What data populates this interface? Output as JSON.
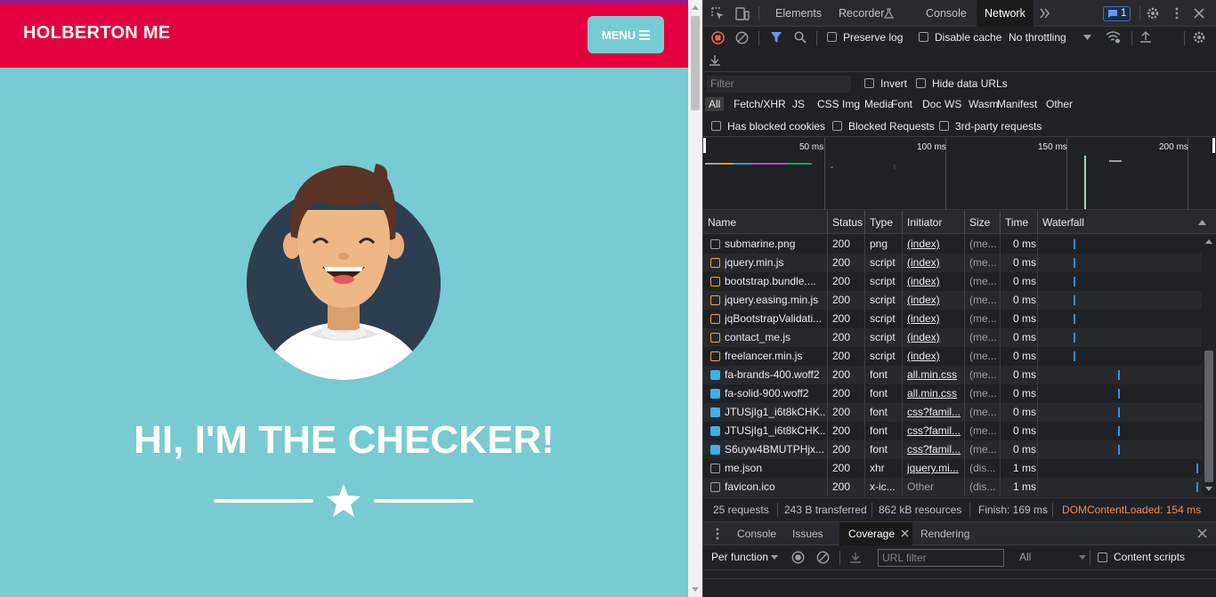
{
  "page": {
    "brand": "HOLBERTON ME",
    "menu_label": "MENU",
    "hero_title": "HI, I'M THE CHECKER!",
    "colors": {
      "navbar": "#e2003e",
      "background": "#78cbd2",
      "text": "#ffffff"
    }
  },
  "devtools": {
    "tabs": [
      "Elements",
      "Recorder",
      "Console",
      "Network"
    ],
    "active_tab": "Network",
    "issues_count": "1",
    "toolbar": {
      "preserve_log": "Preserve log",
      "disable_cache": "Disable cache",
      "throttling": "No throttling"
    },
    "filter": {
      "placeholder": "Filter",
      "invert": "Invert",
      "hide_data_urls": "Hide data URLs",
      "types": [
        "All",
        "Fetch/XHR",
        "JS",
        "CSS",
        "Img",
        "Media",
        "Font",
        "Doc",
        "WS",
        "Wasm",
        "Manifest",
        "Other"
      ],
      "has_blocked_cookies": "Has blocked cookies",
      "blocked_requests": "Blocked Requests",
      "third_party": "3rd-party requests"
    },
    "overview_ticks": [
      "50 ms",
      "100 ms",
      "150 ms",
      "200 ms"
    ],
    "columns": [
      "Name",
      "Status",
      "Type",
      "Initiator",
      "Size",
      "Time",
      "Waterfall"
    ],
    "requests": [
      {
        "name": "submarine.png",
        "status": "200",
        "type": "png",
        "initiator": "(index)",
        "size": "(me...",
        "time": "0 ms",
        "icon": "image-icon",
        "wf": 0.21
      },
      {
        "name": "jquery.min.js",
        "status": "200",
        "type": "script",
        "initiator": "(index)",
        "size": "(me...",
        "time": "0 ms",
        "icon": "script-icon",
        "wf": 0.21
      },
      {
        "name": "bootstrap.bundle....",
        "status": "200",
        "type": "script",
        "initiator": "(index)",
        "size": "(me...",
        "time": "0 ms",
        "icon": "script-icon",
        "wf": 0.21
      },
      {
        "name": "jquery.easing.min.js",
        "status": "200",
        "type": "script",
        "initiator": "(index)",
        "size": "(me...",
        "time": "0 ms",
        "icon": "script-icon",
        "wf": 0.21
      },
      {
        "name": "jqBootstrapValidati...",
        "status": "200",
        "type": "script",
        "initiator": "(index)",
        "size": "(me...",
        "time": "0 ms",
        "icon": "script-icon",
        "wf": 0.21
      },
      {
        "name": "contact_me.js",
        "status": "200",
        "type": "script",
        "initiator": "(index)",
        "size": "(me...",
        "time": "0 ms",
        "icon": "script-icon",
        "wf": 0.21
      },
      {
        "name": "freelancer.min.js",
        "status": "200",
        "type": "script",
        "initiator": "(index)",
        "size": "(me...",
        "time": "0 ms",
        "icon": "script-icon",
        "wf": 0.21
      },
      {
        "name": "fa-brands-400.woff2",
        "status": "200",
        "type": "font",
        "initiator": "all.min.css",
        "size": "(me...",
        "time": "0 ms",
        "icon": "font-icon",
        "wf": 0.49
      },
      {
        "name": "fa-solid-900.woff2",
        "status": "200",
        "type": "font",
        "initiator": "all.min.css",
        "size": "(me...",
        "time": "0 ms",
        "icon": "font-icon",
        "wf": 0.49
      },
      {
        "name": "JTUSjIg1_i6t8kCHK...",
        "status": "200",
        "type": "font",
        "initiator": "css?famil...",
        "size": "(me...",
        "time": "0 ms",
        "icon": "font-icon",
        "wf": 0.49
      },
      {
        "name": "JTUSjIg1_i6t8kCHK...",
        "status": "200",
        "type": "font",
        "initiator": "css?famil...",
        "size": "(me...",
        "time": "0 ms",
        "icon": "font-icon",
        "wf": 0.49
      },
      {
        "name": "S6uyw4BMUTPHjx...",
        "status": "200",
        "type": "font",
        "initiator": "css?famil...",
        "size": "(me...",
        "time": "0 ms",
        "icon": "font-icon",
        "wf": 0.49
      },
      {
        "name": "me.json",
        "status": "200",
        "type": "xhr",
        "initiator": "jquery.mi...",
        "size": "(dis...",
        "time": "1 ms",
        "icon": "xhr-icon",
        "wf": 0.98
      },
      {
        "name": "favicon.ico",
        "status": "200",
        "type": "x-ic...",
        "initiator": "Other",
        "size": "(dis...",
        "time": "1 ms",
        "icon": "xhr-icon",
        "wf": 0.98
      }
    ],
    "status": {
      "requests": "25 requests",
      "transferred": "243 B transferred",
      "resources": "862 kB resources",
      "finish": "Finish: 169 ms",
      "dcl": "DOMContentLoaded: 154 ms"
    },
    "drawer": {
      "tabs": [
        "Console",
        "Issues",
        "Coverage",
        "Rendering"
      ],
      "active_tab": "Coverage",
      "per_function": "Per function",
      "url_filter_placeholder": "URL filter",
      "all": "All",
      "content_scripts": "Content scripts"
    }
  }
}
